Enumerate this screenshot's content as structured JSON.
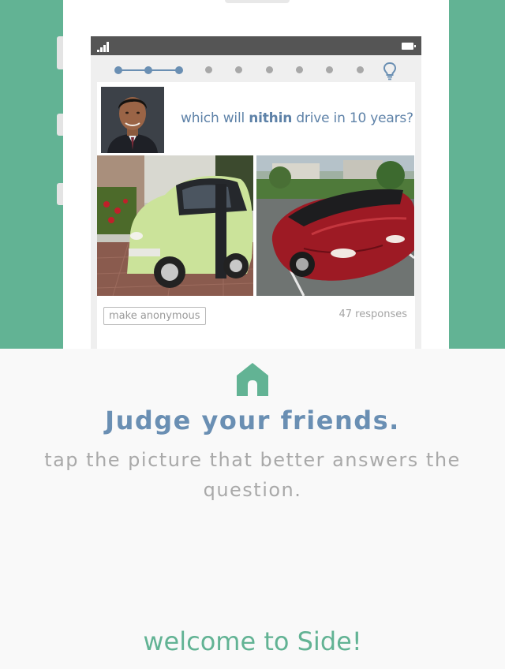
{
  "app": {
    "question_prefix": "which will ",
    "question_name": "nithin",
    "question_suffix": " drive in 10 years?",
    "make_anonymous_label": "make anonymous",
    "responses_label": "47 responses",
    "progress_total_dots": 9,
    "progress_current_step": 3,
    "tip_icon": "lightbulb-icon",
    "left_option": "smart-car-photo",
    "right_option": "red-roadster-photo"
  },
  "onboarding": {
    "icon": "home-icon",
    "headline": "Judge your friends.",
    "subtitle": "tap the picture that better answers the question.",
    "welcome": "welcome to Side!"
  },
  "colors": {
    "hero_green": "#62b394",
    "accent_blue": "#6a8fb3",
    "muted_gray": "#a9a9a9",
    "background": "#f9f9f9"
  }
}
